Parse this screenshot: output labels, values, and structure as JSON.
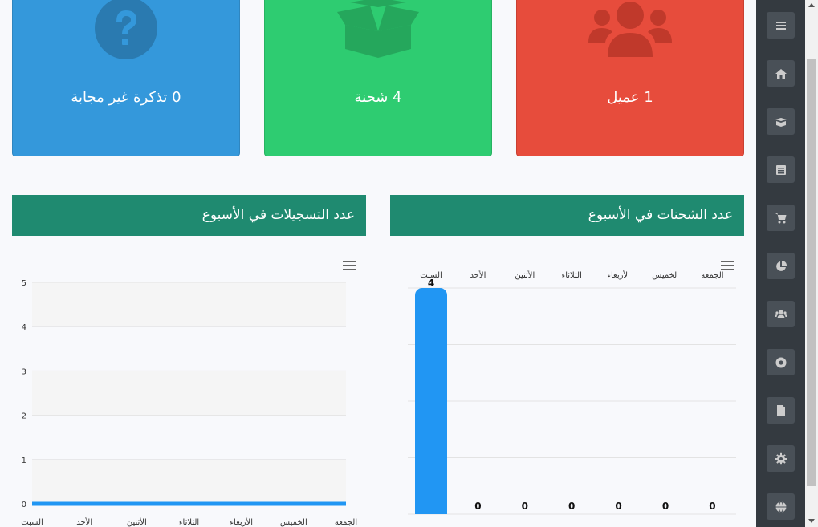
{
  "cards": {
    "tickets": {
      "label": "0 تذكرة غير مجابة",
      "color": "#3498db",
      "icon": "question-circle-icon"
    },
    "shipments": {
      "label": "4 شحنة",
      "color": "#2ecc71",
      "icon": "open-box-icon"
    },
    "clients": {
      "label": "1 عميل",
      "color": "#e74c3c",
      "icon": "users-icon"
    }
  },
  "panels": {
    "registrations_title": "عدد التسجيلات في الأسبوع",
    "shipments_title": "عدد الشحنات في الأسبوع"
  },
  "chart_data": [
    {
      "type": "line",
      "title": "عدد التسجيلات في الأسبوع",
      "categories": [
        "السبت",
        "الأحد",
        "الأثنين",
        "الثلاثاء",
        "الأربعاء",
        "الخميس",
        "الجمعة"
      ],
      "values": [
        0,
        0,
        0,
        0,
        0,
        0,
        0
      ],
      "ylim": [
        0,
        5
      ],
      "yticks": [
        "0",
        "1",
        "2",
        "3",
        "4",
        "5"
      ],
      "color": "#2196f3",
      "grid": true
    },
    {
      "type": "bar",
      "title": "عدد الشحنات في الأسبوع",
      "categories": [
        "السبت",
        "الأحد",
        "الأثنين",
        "الثلاثاء",
        "الأربعاء",
        "الخميس",
        "الجمعة"
      ],
      "values": [
        4,
        0,
        0,
        0,
        0,
        0,
        0
      ],
      "data_labels": [
        "4",
        "0",
        "0",
        "0",
        "0",
        "0",
        "0"
      ],
      "ylim": [
        0,
        4
      ],
      "color": "#2196f3",
      "grid": true
    }
  ],
  "sidebar": {
    "items": [
      {
        "icon": "menu-icon"
      },
      {
        "icon": "home-icon"
      },
      {
        "icon": "box-icon"
      },
      {
        "icon": "list-icon"
      },
      {
        "icon": "cart-icon"
      },
      {
        "icon": "pie-chart-icon"
      },
      {
        "icon": "users-icon"
      },
      {
        "icon": "lifebuoy-icon"
      },
      {
        "icon": "file-icon"
      },
      {
        "icon": "gear-icon"
      },
      {
        "icon": "globe-icon"
      }
    ]
  }
}
